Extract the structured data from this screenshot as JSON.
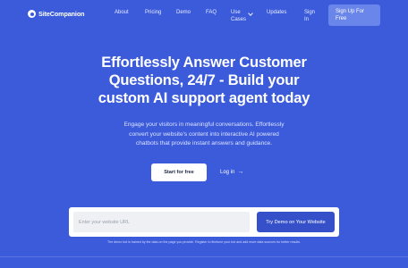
{
  "nav": {
    "logo_text": "SiteCompanion",
    "links": [
      "About",
      "Pricing",
      "Demo",
      "FAQ"
    ],
    "use_cases_line1": "Use",
    "use_cases_line2": "Cases",
    "updates": "Updates",
    "sign_in_line1": "Sign",
    "sign_in_line2": "In",
    "signup_line1": "Sign Up For",
    "signup_line2": "Free"
  },
  "hero": {
    "title_line1": "Effortlessly Answer Customer",
    "title_line2": "Questions, 24/7 - Build your",
    "title_line3": "custom AI support agent today",
    "subtitle_line1": "Engage your visitors in meaningful conversations. Effortlessly",
    "subtitle_line2": "convert your website's content into interactive AI powered",
    "subtitle_line3": "chatbots that provide instant answers and guidance.",
    "start_label": "Start for free",
    "login_label": "Log in",
    "login_arrow": "→"
  },
  "demo": {
    "url_placeholder": "Enter your website URL",
    "url_value": "",
    "try_label": "Try Demo on Your Website",
    "disclaimer": "The demo bot is trained by the data on the page you provide. Register to finetune your bot and add more data sources for better results."
  },
  "colors": {
    "background": "#3b5bdb",
    "signup_button": "#6b86ea",
    "try_button": "#3550c8"
  }
}
